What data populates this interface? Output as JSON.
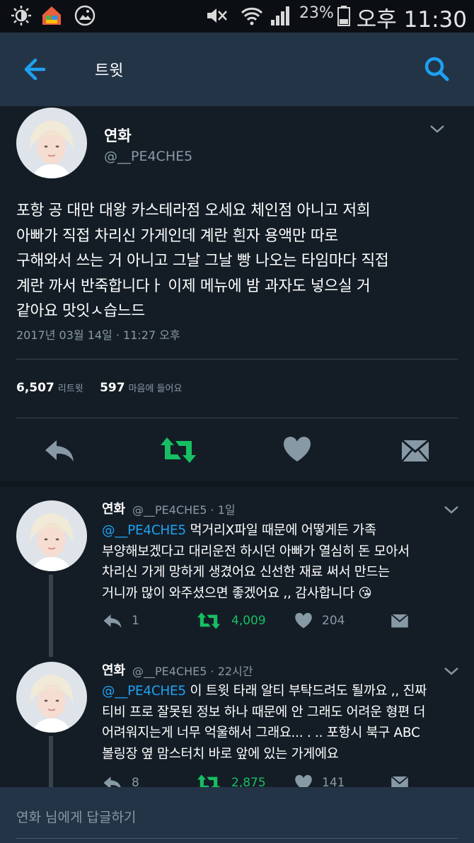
{
  "status_bar": {
    "battery": "23%",
    "time": "오후 11:30"
  },
  "header": {
    "title": "트윗"
  },
  "main_tweet": {
    "name": "연화",
    "handle": "@__PE4CHE5",
    "body": "포항 공 대만 대왕 카스테라점 오세요 체인점 아니고 저희\n아빠가 직접 차리신 가게인데 계란 흰자 용액만 따로\n구해와서 쓰는 거 아니고 그날 그날 빵 나오는 타임마다 직접\n계란 까서 반죽합니다ㅏ 이제 메뉴에 밤 과자도 넣으실 거\n같아요 맛잇ㅅ습느드",
    "date": "2017년 03월 14일 · 11:27 오후",
    "retweets": "6,507",
    "retweets_label": "리트윗",
    "likes": "597",
    "likes_label": "마음에 들어요"
  },
  "replies": [
    {
      "name": "연화",
      "handle_time": "@__PE4CHE5 · 1일",
      "mention": "@__PE4CHE5",
      "text": " 먹거리X파일 때문에 어떻게든 가족\n부양해보겠다고 대리운전 하시던 아빠가 열심히 돈 모아서\n차리신 가게 망하게 생겼어요 신선한 재료 써서 만드는\n거니까 많이 와주셨으면 좋겠어요 ,, 감사합니다 😘",
      "reply_count": "1",
      "retweet_count": "4,009",
      "like_count": "204"
    },
    {
      "name": "연화",
      "handle_time": "@__PE4CHE5 · 22시간",
      "mention": "@__PE4CHE5",
      "text": " 이 트윗 타래 알티 부탁드려도 될까요 ,, 진짜\n티비 프로 잘못된 정보 하나 때문에 안 그래도 어려운 형편 더\n어려워지는게 너무 억울해서 그래요... . .. 포항시 북구 ABC\n볼링장 옆 맘스터치 바로 앞에 있는 가게에요",
      "reply_count": "8",
      "retweet_count": "2,875",
      "like_count": "141"
    }
  ],
  "reply_bar": {
    "placeholder": "연화 님에게 답글하기"
  },
  "colors": {
    "background": "#141d26",
    "appbar": "#243447",
    "accent": "#1da1f2",
    "retweet_green": "#17bf63",
    "muted": "#8899a6"
  },
  "icons": [
    "back-arrow-icon",
    "search-icon",
    "reply-icon",
    "retweet-icon",
    "heart-icon",
    "message-icon",
    "chevron-down-icon"
  ]
}
